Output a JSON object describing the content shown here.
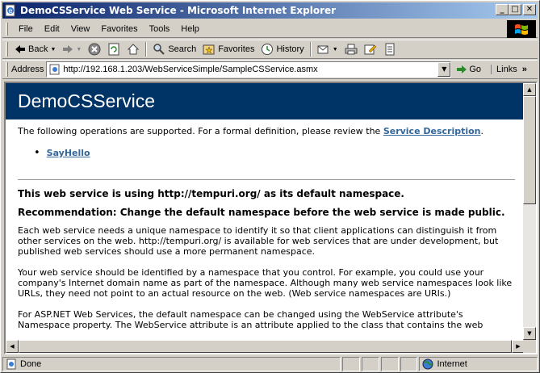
{
  "window": {
    "title": "DemoCSService Web Service - Microsoft Internet Explorer",
    "min": "_",
    "max": "□",
    "close": "✕"
  },
  "menu": [
    "File",
    "Edit",
    "View",
    "Favorites",
    "Tools",
    "Help"
  ],
  "toolbar": {
    "back": "Back",
    "search": "Search",
    "favorites": "Favorites",
    "history": "History"
  },
  "address": {
    "label": "Address",
    "url": "http://192.168.1.203/WebServiceSimple/SampleCSService.asmx",
    "go": "Go",
    "links": "Links",
    "links_more": "»"
  },
  "page": {
    "heading": "DemoCSService",
    "intro": "The following operations are supported. For a formal definition, please review the ",
    "service_description_link": "Service Description",
    "intro_end": ".",
    "operations": [
      "SayHello"
    ],
    "ns_heading": "This web service is using http://tempuri.org/ as its default namespace.",
    "recommendation_heading": "Recommendation: Change the default namespace before the web service is made public.",
    "para1": "Each web service needs a unique namespace to identify it so that client applications can distinguish it from other services on the web. http://tempuri.org/ is available for web services that are under development, but published web services should use a more permanent namespace.",
    "para2": "Your web service should be identified by a namespace that you control. For example, you could use your company's Internet domain name as part of the namespace. Although many web service namespaces look like URLs, they need not point to an actual resource on the web. (Web service namespaces are URIs.)",
    "para3": "For ASP.NET Web Services, the default namespace can be changed using the WebService attribute's Namespace property. The WebService attribute is an attribute applied to the class that contains the web"
  },
  "status": {
    "text": "Done",
    "zone": "Internet"
  },
  "colors": {
    "banner": "#003366",
    "link": "#336699",
    "titlebar_start": "#0a246a",
    "titlebar_end": "#a6caf0"
  }
}
